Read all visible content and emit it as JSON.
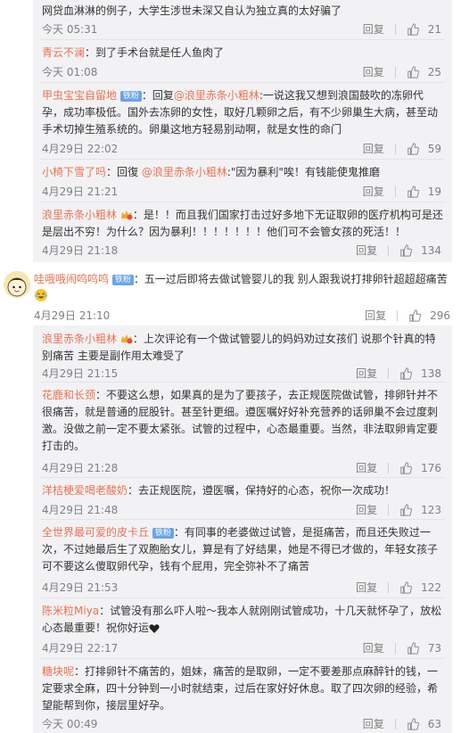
{
  "ui": {
    "reply": "回复",
    "fan_badge": "铁粉",
    "like_icon": "thumbs-up-icon"
  },
  "colors": {
    "username": "#eb7350",
    "meta": "#808080",
    "sub_bg": "#f2f2f5",
    "badge": "#6aa4e8"
  },
  "top_replies": [
    {
      "text": "网贷血淋淋的例子，大学生涉世未深又自认为独立真的太好骗了",
      "time": "今天 05:31",
      "likes": "21"
    },
    {
      "user": "青云不澜",
      "text": "：到了手术台就是任人鱼肉了",
      "time": "今天 01:08",
      "likes": "25"
    },
    {
      "user": "甲虫宝宝自留地",
      "badge": "铁粉",
      "text_pre": "：回复",
      "mention": "@浪里赤条小粗林",
      "text": ":一说这我又想到浪国鼓吹的冻卵代孕，成功率极低。国外去冻卵的女性，取好几颗卵之后，有不少卵巢生大病，甚至动手术切掉生殖系统的。卵巢这地方轻易别动啊，就是女性的命门",
      "time": "4月29日 22:02",
      "likes": "59"
    },
    {
      "user": "小椅下雪了吗",
      "text_pre": "：回復 ",
      "mention": "@浪里赤条小粗林",
      "text": ":\"因为暴利\"唉！有钱能使鬼推磨",
      "time": "4月29日 21:21",
      "likes": "19"
    },
    {
      "user": "浪里赤条小粗林",
      "text": "：是！！而且我们国家打击过好多地下无证取卵的医疗机构可是还是层出不穷！为什么？因为暴利！！！！！！！他们可不会管女孩的死活！！",
      "time": "4月29日 21:18",
      "likes": "134"
    }
  ],
  "main_comment": {
    "user": "哇哦哦闹呜呜呜",
    "badge": "铁粉",
    "text": "：五一过后即将去做试管婴儿的我 别人跟我说打排卵针超超超痛苦",
    "time": "4月29日 21:10",
    "likes": "296"
  },
  "sub_replies": [
    {
      "user": "浪里赤条小粗林",
      "text": "：上次评论有一个做试管婴儿的妈妈劝过女孩们 说那个针真的特别痛苦 主要是副作用太难受了",
      "time": "4月29日 21:15",
      "likes": "138"
    },
    {
      "user": "花鹿和长颈",
      "text": "：不要这么想，如果真的是为了要孩子，去正规医院做试管，排卵针并不很痛苦，就是普通的屁股针。甚至针更细。遵医嘱好好补充营养的话卵巢不会过度刺激。没做之前一定不要太紧张。试管的过程中，心态最重要。当然，非法取卵肯定要打击的。",
      "time": "4月29日 21:28",
      "likes": "176"
    },
    {
      "user": "洋桔梗爱喝老酸奶",
      "text": "：去正规医院，遵医嘱，保持好的心态，祝你一次成功！",
      "time": "4月29日 21:48",
      "likes": "123"
    },
    {
      "user": "全世界最可爱的皮卡丘",
      "badge": "铁粉",
      "text": "：有同事的老婆做过试管，是挺痛苦，而且还失败过一次，不过她最后生了双胞胎女儿，算是有了好结果，她是不得已才做的，年轻女孩子可不要这么傻取卵代孕，钱有个屁用，完全弥补不了痛苦",
      "time": "4月29日 21:53",
      "likes": "122"
    },
    {
      "user": "陈米粒Miya",
      "text": "：试管没有那么吓人啦～我本人就刚刚试管成功，十几天就怀孕了，放松心态最重要！祝你好运",
      "time": "4月29日 22:17",
      "likes": "73"
    },
    {
      "user": "糖块呢",
      "text": "：打排卵针不痛苦的，姐妹，痛苦的是取卵，一定不要差那点麻醉针的钱，一定要求全麻，四十分钟到一小时就结束，过后在家好好休息。取了四次卵的经验，希望能帮到你，接层里好孕。",
      "time": "今天 00:49",
      "likes": "63"
    }
  ]
}
